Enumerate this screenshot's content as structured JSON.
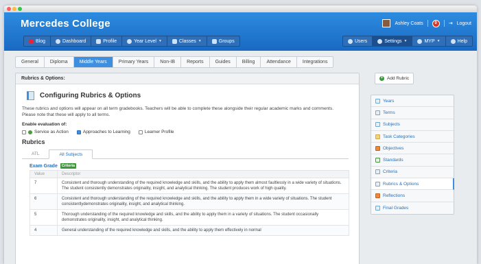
{
  "header": {
    "app_title": "Mercedes College",
    "user_name": "Ashley Coats",
    "notification_count": "0",
    "logout_label": "Logout"
  },
  "nav": {
    "left": [
      {
        "label": "Blog",
        "badge": "0"
      },
      {
        "label": "Dashboard"
      },
      {
        "label": "Profile"
      },
      {
        "label": "Year Level",
        "dropdown": true
      },
      {
        "label": "Classes",
        "dropdown": true
      },
      {
        "label": "Groups"
      }
    ],
    "right": [
      {
        "label": "Users"
      },
      {
        "label": "Settings",
        "dropdown": true,
        "active": true
      },
      {
        "label": "MYP",
        "dropdown": true
      },
      {
        "label": "Help"
      }
    ]
  },
  "tabs": [
    "General",
    "Diploma",
    "Middle Years",
    "Primary Years",
    "Non-IB",
    "Reports",
    "Guides",
    "Billing",
    "Attendance",
    "Integrations"
  ],
  "active_tab": "Middle Years",
  "panel": {
    "header": "Rubrics & Options:",
    "title": "Configuring Rubrics & Options",
    "description": "These rubrics and options will appear on all term gradebooks. Teachers will be able to complete these alongside their regular academic marks and comments. Please note that these will apply to all terms.",
    "enable_label": "Enable evaluation of:",
    "options": [
      {
        "label": "Service as Action",
        "checked": false
      },
      {
        "label": "Approaches to Learning",
        "checked": true
      },
      {
        "label": "Learner Profile",
        "checked": false
      }
    ],
    "rubrics_heading": "Rubrics",
    "rubric_tabs": [
      "ATL",
      "All Subjects"
    ],
    "active_rubric_tab": "All Subjects",
    "exam_title": "Exam Grade",
    "exam_badge": "Criteria",
    "table_headers": [
      "Value",
      "Descriptor"
    ],
    "rows": [
      {
        "value": "7",
        "descriptor": "Consistent and thorough understanding of the required knowledge and skills, and the ability to apply them almost faultlessly in a wide variety of situations. The student consistently demonstrates originality, insight, and analytical thinking. The student produces work of high quality."
      },
      {
        "value": "6",
        "descriptor": "Consistent and thorough understanding of the required knowledge and skills, and the ability to apply them in a wide variety of situations. The student consistentlydemonstrates originality, insight, and analytical thinking."
      },
      {
        "value": "5",
        "descriptor": "Thorough understanding of the required knowledge and skills, and the ability to apply them in a variety of situations. The student occasionally demonstrates originality, insight, and analytical thinking."
      },
      {
        "value": "4",
        "descriptor": "General understanding of the required knowledge and skills, and the ability to apply them effectively in normal"
      }
    ]
  },
  "add_rubric_label": "Add Rubric",
  "sidebar": {
    "items": [
      {
        "label": "Years",
        "icon": "calendar-icon"
      },
      {
        "label": "Terms",
        "icon": "calendar-icon"
      },
      {
        "label": "Subjects",
        "icon": "books-icon"
      },
      {
        "label": "Task Categories",
        "icon": "folder-icon"
      },
      {
        "label": "Objectives",
        "icon": "target-icon"
      },
      {
        "label": "Standards",
        "icon": "checklist-icon"
      },
      {
        "label": "Criteria",
        "icon": "list-icon"
      },
      {
        "label": "Rubrics & Options",
        "icon": "table-icon",
        "active": true
      },
      {
        "label": "Reflections",
        "icon": "bulb-icon"
      },
      {
        "label": "Final Grades",
        "icon": "grid-icon"
      }
    ]
  },
  "colors": {
    "brand": "#1f76d0",
    "accent": "#3d8fe0",
    "success": "#3a9a3a",
    "alert": "#dd3322"
  }
}
